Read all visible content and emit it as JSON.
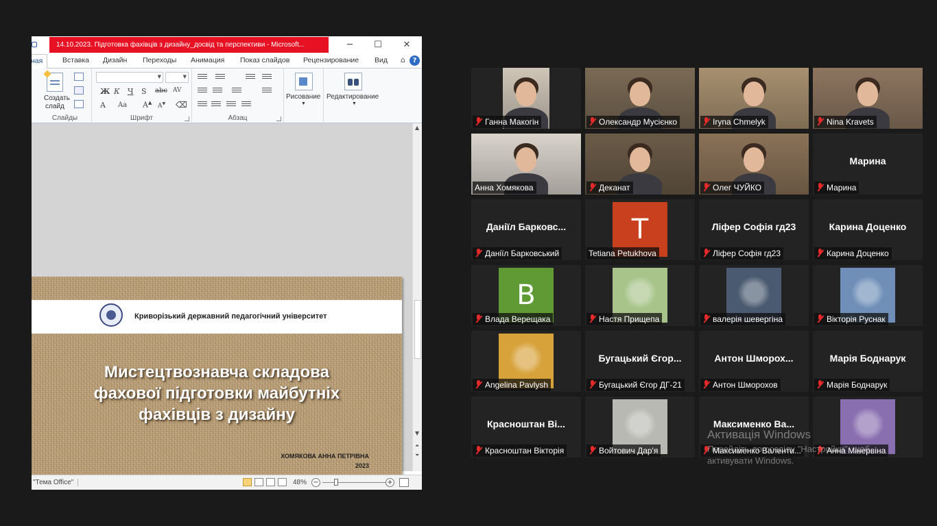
{
  "ppt": {
    "title": "14.10.2023. Підготовка фахівців з дизайну_досвід та перспективи  -  Microsoft...",
    "tabs": [
      "ная",
      "Вставка",
      "Дизайн",
      "Переходы",
      "Анимация",
      "Показ слайдов",
      "Рецензирование",
      "Вид"
    ],
    "ribbon": {
      "create_slide": "Создать",
      "create_slide_2": "слайд",
      "group_slides": "Слайды",
      "group_font": "Шрифт",
      "group_paragraph": "Абзац",
      "drawing": "Рисование",
      "editing": "Редактирование"
    },
    "slide": {
      "university": "Криворізький  державний  педагогічний  університет",
      "title_line1": "Мистецтвознавча складова",
      "title_line2": "фахової підготовки майбутніх",
      "title_line3": "фахівців з дизайну",
      "author": "ХОМЯКОВА АННА ПЕТРІВНА",
      "year": "2023"
    },
    "status": {
      "theme": "\"Тема Office\"",
      "zoom": "48%"
    }
  },
  "gallery": {
    "participants": [
      {
        "label": "Ганна Макогін",
        "muted": true,
        "type": "video",
        "bg": "#cfc6b8"
      },
      {
        "label": "Олександр Мусієнко",
        "muted": true,
        "type": "video",
        "bg": "#7a6a55"
      },
      {
        "label": "Iryna Chmelyk",
        "muted": true,
        "type": "video",
        "bg": "#a89070"
      },
      {
        "label": "Nina Kravets",
        "muted": true,
        "type": "video",
        "bg": "#8d7560"
      },
      {
        "label": "Анна Хомякова",
        "muted": false,
        "type": "video",
        "bg": "#d9d3cc",
        "active": true
      },
      {
        "label": "Деканат",
        "muted": true,
        "type": "video",
        "bg": "#6b5b48"
      },
      {
        "label": "Олег ЧУЙКО",
        "muted": true,
        "type": "video",
        "bg": "#8a7258"
      },
      {
        "label": "Марина",
        "muted": true,
        "type": "name",
        "big": "Марина"
      },
      {
        "label": "Даніїл Барковський",
        "muted": true,
        "type": "name",
        "big": "Даніїл  Барковс..."
      },
      {
        "label": "Tetiana Petukhova",
        "muted": false,
        "type": "avatar",
        "letter": "T",
        "bg": "#c8401e"
      },
      {
        "label": "Ліфер Софія гд23",
        "muted": true,
        "type": "name",
        "big": "Ліфер Софія гд23"
      },
      {
        "label": "Карина Доценко",
        "muted": true,
        "type": "name",
        "big": "Карина Доценко"
      },
      {
        "label": "Влада Верещака",
        "muted": true,
        "type": "avatar",
        "letter": "B",
        "bg": "#5f9a34"
      },
      {
        "label": "Настя Прищепа",
        "muted": true,
        "type": "picture",
        "bg": "#a8c48a"
      },
      {
        "label": "валерія шевергіна",
        "muted": true,
        "type": "picture",
        "bg": "#4a5a70"
      },
      {
        "label": "Вікторія Руснак",
        "muted": true,
        "type": "picture",
        "bg": "#6f8fb8"
      },
      {
        "label": "Angelina Pavlysh",
        "muted": true,
        "type": "picture",
        "bg": "#d7a23a"
      },
      {
        "label": "Бугацький Єгор ДГ-21",
        "muted": true,
        "type": "name",
        "big": "Бугацький  Єгор..."
      },
      {
        "label": "Антон Шморохов",
        "muted": true,
        "type": "name",
        "big": "Антон  Шморох..."
      },
      {
        "label": "Марія Боднарук",
        "muted": true,
        "type": "name",
        "big": "Марія Боднарук"
      },
      {
        "label": "Красноштан Вікторія",
        "muted": true,
        "type": "name",
        "big": "Красноштан  Ві..."
      },
      {
        "label": "Войтович Дар'я",
        "muted": true,
        "type": "picture",
        "bg": "#b9b9b3"
      },
      {
        "label": "Максименко Валенти...",
        "muted": true,
        "type": "name",
        "big": "Максименко  Ва..."
      },
      {
        "label": "Анна Мінервіна",
        "muted": true,
        "type": "picture",
        "bg": "#8a6fb0"
      }
    ]
  },
  "watermark": {
    "title": "Активація Windows",
    "line1": "Перейдіть до розділу \"Настройки\", щоб",
    "line2": "активувати Windows."
  }
}
